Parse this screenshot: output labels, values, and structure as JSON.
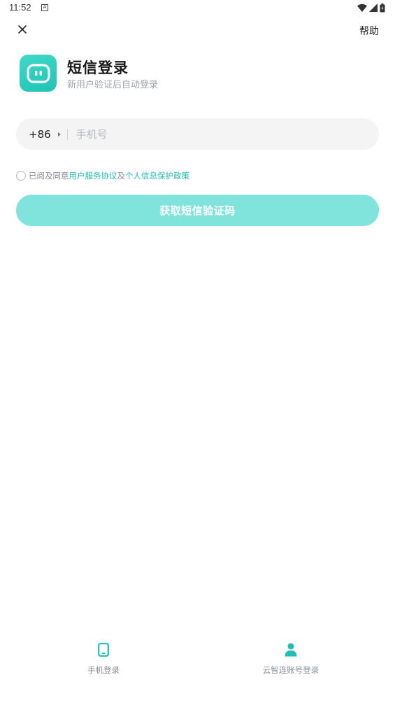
{
  "status_bar": {
    "time": "11:52",
    "notification_glyph": "A"
  },
  "header": {
    "close_icon": "close-icon",
    "help_label": "帮助"
  },
  "title_block": {
    "logo_icon": "robot-face-icon",
    "title": "短信登录",
    "subtitle": "新用户验证后自动登录"
  },
  "phone_form": {
    "country_code": "+86",
    "phone_value": "",
    "phone_placeholder": "手机号"
  },
  "agreement": {
    "prefix": "已阅及同意",
    "terms_link": "用户服务协议",
    "connector": "及",
    "privacy_link": "个人信息保护政策",
    "checked": false
  },
  "submit": {
    "label": "获取短信验证码"
  },
  "login_options": [
    {
      "icon": "smartphone-icon",
      "label": "手机登录"
    },
    {
      "icon": "person-icon",
      "label": "云智连账号登录"
    }
  ],
  "colors": {
    "accent": "#1fbfb3",
    "button_disabled": "#80e3dc",
    "logo": "#2ccfbf"
  }
}
